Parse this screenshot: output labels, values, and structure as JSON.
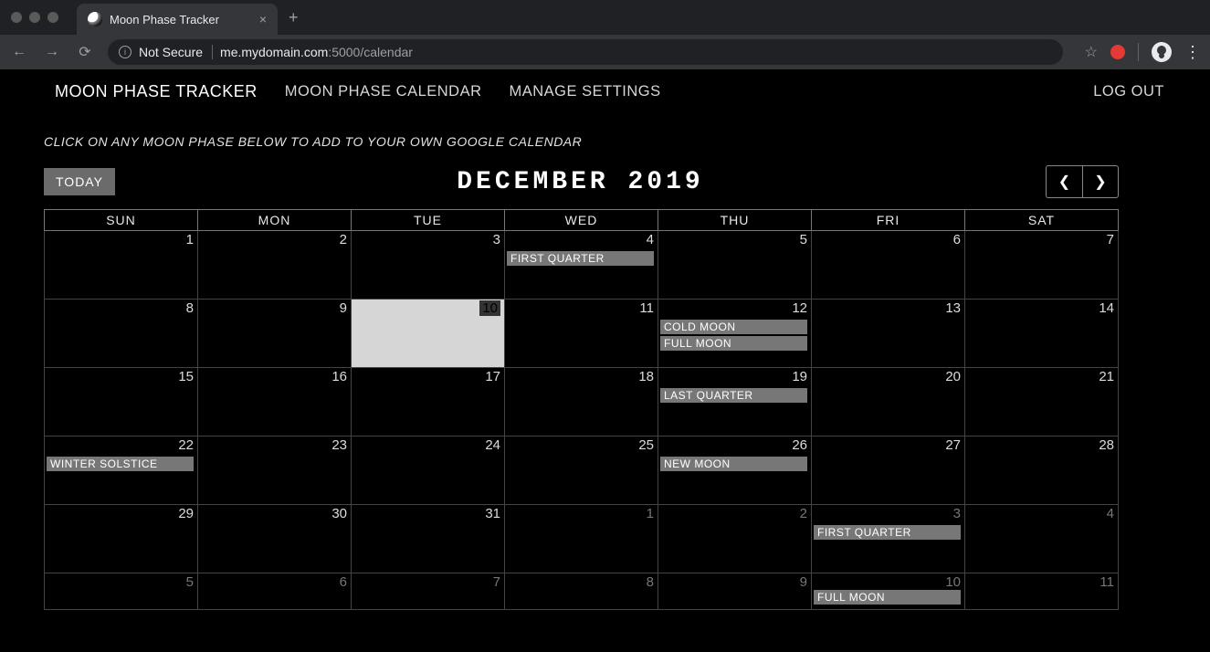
{
  "browser": {
    "tab_title": "Moon Phase Tracker",
    "url_secure_label": "Not Secure",
    "url_host": "me.mydomain.com",
    "url_port_path": ":5000/calendar"
  },
  "nav": {
    "brand": "MOON PHASE TRACKER",
    "calendar": "MOON PHASE CALENDAR",
    "settings": "MANAGE SETTINGS",
    "logout": "LOG OUT"
  },
  "hint": "CLICK ON ANY MOON PHASE BELOW TO ADD TO YOUR OWN GOOGLE CALENDAR",
  "toolbar": {
    "today_label": "TODAY",
    "month_title": "DECEMBER 2019"
  },
  "daynames": [
    "SUN",
    "MON",
    "TUE",
    "WED",
    "THU",
    "FRI",
    "SAT"
  ],
  "weeks": [
    [
      {
        "n": "1"
      },
      {
        "n": "2"
      },
      {
        "n": "3"
      },
      {
        "n": "4",
        "events": [
          "FIRST QUARTER"
        ]
      },
      {
        "n": "5"
      },
      {
        "n": "6"
      },
      {
        "n": "7"
      }
    ],
    [
      {
        "n": "8"
      },
      {
        "n": "9"
      },
      {
        "n": "10",
        "today": true
      },
      {
        "n": "11"
      },
      {
        "n": "12",
        "events": [
          "COLD MOON",
          "FULL MOON"
        ]
      },
      {
        "n": "13"
      },
      {
        "n": "14"
      }
    ],
    [
      {
        "n": "15"
      },
      {
        "n": "16"
      },
      {
        "n": "17"
      },
      {
        "n": "18"
      },
      {
        "n": "19",
        "events": [
          "LAST QUARTER"
        ]
      },
      {
        "n": "20"
      },
      {
        "n": "21"
      }
    ],
    [
      {
        "n": "22",
        "events": [
          "WINTER SOLSTICE"
        ]
      },
      {
        "n": "23"
      },
      {
        "n": "24"
      },
      {
        "n": "25"
      },
      {
        "n": "26",
        "events": [
          "NEW MOON"
        ]
      },
      {
        "n": "27"
      },
      {
        "n": "28"
      }
    ],
    [
      {
        "n": "29"
      },
      {
        "n": "30"
      },
      {
        "n": "31"
      },
      {
        "n": "1",
        "other": true
      },
      {
        "n": "2",
        "other": true
      },
      {
        "n": "3",
        "other": true,
        "events": [
          "FIRST QUARTER"
        ]
      },
      {
        "n": "4",
        "other": true
      }
    ],
    [
      {
        "n": "5",
        "other": true
      },
      {
        "n": "6",
        "other": true
      },
      {
        "n": "7",
        "other": true
      },
      {
        "n": "8",
        "other": true
      },
      {
        "n": "9",
        "other": true
      },
      {
        "n": "10",
        "other": true,
        "events": [
          "FULL MOON"
        ]
      },
      {
        "n": "11",
        "other": true
      }
    ]
  ]
}
